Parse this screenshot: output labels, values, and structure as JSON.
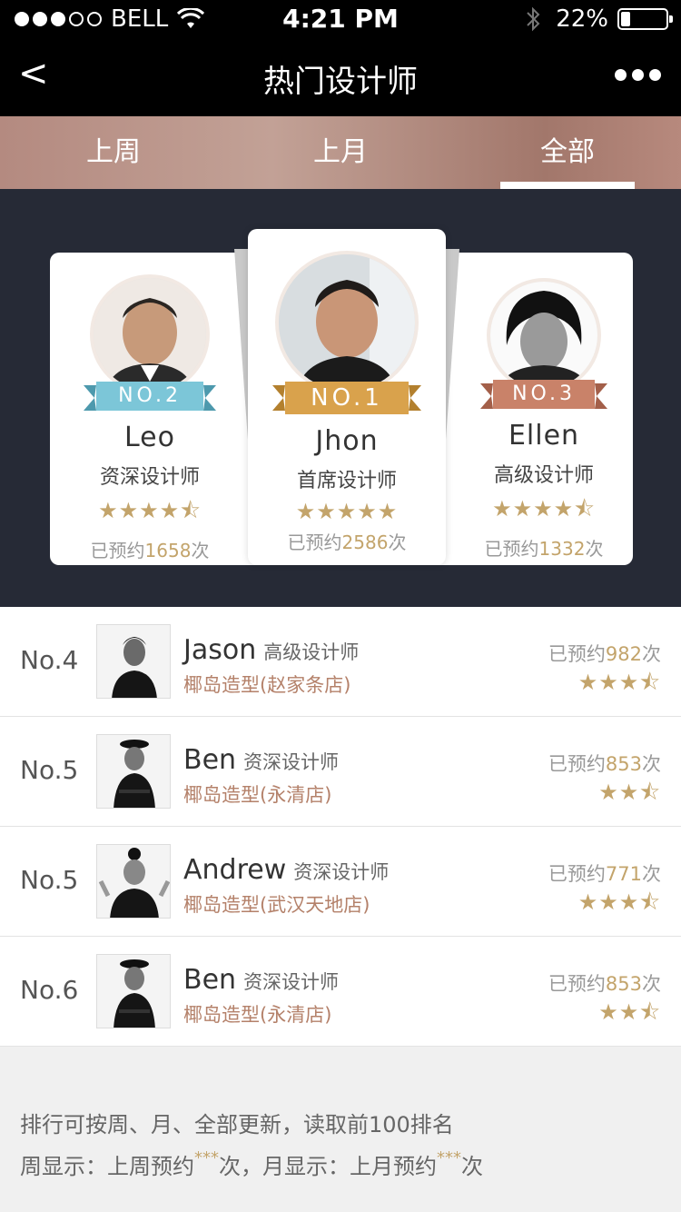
{
  "status_bar": {
    "carrier": "BELL",
    "time": "4:21 PM",
    "battery": "22%"
  },
  "nav": {
    "back": "<",
    "title": "热门设计师"
  },
  "tabs": [
    {
      "label": "上周",
      "active": false
    },
    {
      "label": "上月",
      "active": false
    },
    {
      "label": "全部",
      "active": true
    }
  ],
  "podium": [
    {
      "rank": "NO.2",
      "name": "Leo",
      "title": "资深设计师",
      "stars": "★★★★⯪",
      "count_prefix": "已预约",
      "count": "1658",
      "count_suffix": "次"
    },
    {
      "rank": "NO.1",
      "name": "Jhon",
      "title": "首席设计师",
      "stars": "★★★★★",
      "count_prefix": "已预约",
      "count": "2586",
      "count_suffix": "次"
    },
    {
      "rank": "NO.3",
      "name": "Ellen",
      "title": "高级设计师",
      "stars": "★★★★⯪",
      "count_prefix": "已预约",
      "count": "1332",
      "count_suffix": "次"
    }
  ],
  "list": [
    {
      "rank": "No.4",
      "name": "Jason",
      "title": "高级设计师",
      "shop": "椰岛造型(赵家条店)",
      "count_prefix": "已预约",
      "count": "982",
      "count_suffix": "次",
      "stars": "★★★⯪"
    },
    {
      "rank": "No.5",
      "name": "Ben",
      "title": "资深设计师",
      "shop": "椰岛造型(永清店)",
      "count_prefix": "已预约",
      "count": "853",
      "count_suffix": "次",
      "stars": "★★⯪"
    },
    {
      "rank": "No.5",
      "name": "Andrew",
      "title": "资深设计师",
      "shop": "椰岛造型(武汉天地店)",
      "count_prefix": "已预约",
      "count": "771",
      "count_suffix": "次",
      "stars": "★★★⯪"
    },
    {
      "rank": "No.6",
      "name": "Ben",
      "title": "资深设计师",
      "shop": "椰岛造型(永清店)",
      "count_prefix": "已预约",
      "count": "853",
      "count_suffix": "次",
      "stars": "★★⯪"
    }
  ],
  "footer": {
    "line1": "排行可按周、月、全部更新，读取前100排名",
    "line2_a": "周显示：上周预约",
    "line2_ast1": "***",
    "line2_b": "次，月显示：上月预约",
    "line2_ast2": "***",
    "line2_c": "次"
  },
  "colors": {
    "gold": "#c3a46b",
    "shop": "#b4816a",
    "dark_bg": "#262a36",
    "ribbon_no1": "#d9a24c",
    "ribbon_no2": "#7cc6d8",
    "ribbon_no3": "#c98269"
  }
}
